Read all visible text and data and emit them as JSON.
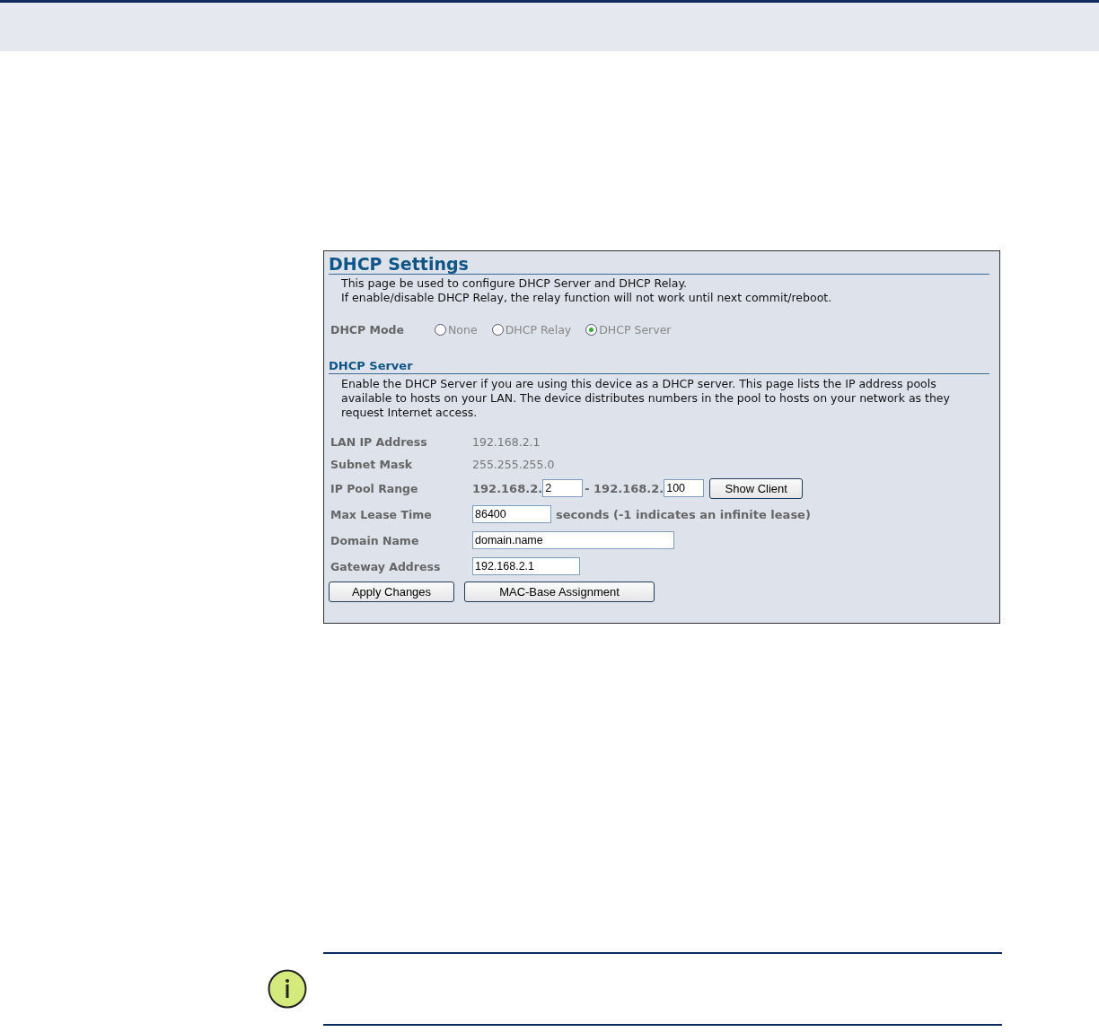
{
  "panel": {
    "title": "DHCP Settings",
    "intro": [
      "This page be used to configure DHCP Server and DHCP Relay.",
      "If enable/disable DHCP Relay, the relay function will not work until next commit/reboot."
    ],
    "mode": {
      "label": "DHCP Mode",
      "options": [
        {
          "label": "None",
          "selected": false
        },
        {
          "label": "DHCP Relay",
          "selected": false
        },
        {
          "label": "DHCP Server",
          "selected": true
        }
      ]
    },
    "section": {
      "title": "DHCP Server",
      "text": "Enable the DHCP Server if you are using this device as a DHCP server. This page lists the IP address pools available to hosts on your LAN. The device distributes numbers in the pool to hosts on your network as they request Internet access."
    },
    "rows": [
      {
        "kind": "text",
        "label": "LAN IP Address",
        "value": "192.168.2.1"
      },
      {
        "kind": "text",
        "label": "Subnet Mask",
        "value": "255.255.255.0"
      },
      {
        "kind": "range",
        "label": "IP Pool Range",
        "prefix_start": "192.168.2.",
        "start": "2",
        "prefix_end": "- 192.168.2.",
        "end": "100",
        "button": "Show Client"
      },
      {
        "kind": "field",
        "label": "Max Lease Time",
        "value": "86400",
        "suffix": "seconds (-1 indicates an infinite lease)"
      },
      {
        "kind": "field",
        "label": "Domain Name",
        "value": "domain.name"
      },
      {
        "kind": "field",
        "label": "Gateway Address",
        "value": "192.168.2.1"
      }
    ],
    "buttons": [
      "Apply Changes",
      "MAC-Base Assignment"
    ]
  }
}
